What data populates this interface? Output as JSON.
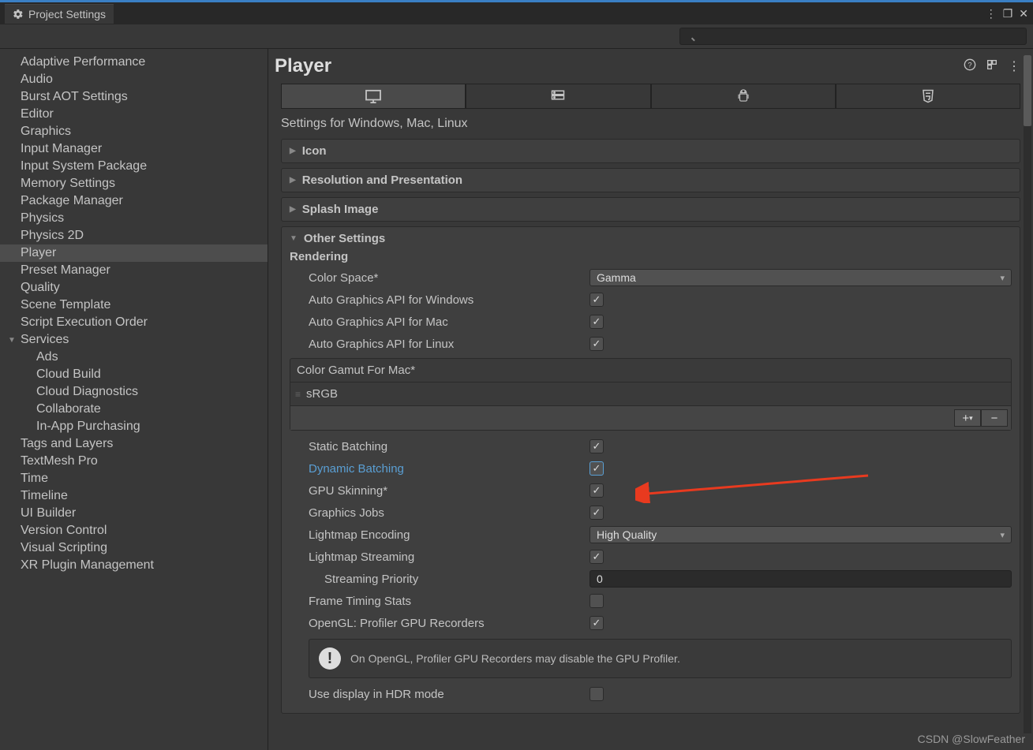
{
  "window": {
    "title": "Project Settings"
  },
  "search": {
    "placeholder": ""
  },
  "sidebar": {
    "items": [
      {
        "label": "Adaptive Performance"
      },
      {
        "label": "Audio"
      },
      {
        "label": "Burst AOT Settings"
      },
      {
        "label": "Editor"
      },
      {
        "label": "Graphics"
      },
      {
        "label": "Input Manager"
      },
      {
        "label": "Input System Package"
      },
      {
        "label": "Memory Settings"
      },
      {
        "label": "Package Manager"
      },
      {
        "label": "Physics"
      },
      {
        "label": "Physics 2D"
      },
      {
        "label": "Player",
        "selected": true
      },
      {
        "label": "Preset Manager"
      },
      {
        "label": "Quality"
      },
      {
        "label": "Scene Template"
      },
      {
        "label": "Script Execution Order"
      }
    ],
    "services": {
      "label": "Services",
      "children": [
        {
          "label": "Ads"
        },
        {
          "label": "Cloud Build"
        },
        {
          "label": "Cloud Diagnostics"
        },
        {
          "label": "Collaborate"
        },
        {
          "label": "In-App Purchasing"
        }
      ]
    },
    "items2": [
      {
        "label": "Tags and Layers"
      },
      {
        "label": "TextMesh Pro"
      },
      {
        "label": "Time"
      },
      {
        "label": "Timeline"
      },
      {
        "label": "UI Builder"
      },
      {
        "label": "Version Control"
      },
      {
        "label": "Visual Scripting"
      },
      {
        "label": "XR Plugin Management"
      }
    ]
  },
  "content": {
    "title": "Player",
    "platform_section": "Settings for Windows, Mac, Linux",
    "foldouts": {
      "icon": "Icon",
      "resolution": "Resolution and Presentation",
      "splash": "Splash Image",
      "other": "Other Settings"
    },
    "rendering": {
      "heading": "Rendering",
      "color_space_label": "Color Space*",
      "color_space_value": "Gamma",
      "auto_win": "Auto Graphics API  for Windows",
      "auto_mac": "Auto Graphics API  for Mac",
      "auto_linux": "Auto Graphics API  for Linux",
      "gamut_header": "Color Gamut For Mac*",
      "gamut_item": "sRGB",
      "static_batching": "Static Batching",
      "dynamic_batching": "Dynamic Batching",
      "gpu_skinning": "GPU Skinning*",
      "graphics_jobs": "Graphics Jobs",
      "lightmap_encoding_label": "Lightmap Encoding",
      "lightmap_encoding_value": "High Quality",
      "lightmap_streaming": "Lightmap Streaming",
      "streaming_priority_label": "Streaming Priority",
      "streaming_priority_value": "0",
      "frame_timing": "Frame Timing Stats",
      "opengl_recorders": "OpenGL: Profiler GPU Recorders",
      "info_text": "On OpenGL, Profiler GPU Recorders may disable the GPU Profiler.",
      "hdr_mode": "Use display in HDR mode",
      "checks": {
        "auto_win": true,
        "auto_mac": true,
        "auto_linux": true,
        "static_batching": true,
        "dynamic_batching": true,
        "gpu_skinning": true,
        "graphics_jobs": true,
        "lightmap_streaming": true,
        "frame_timing": false,
        "opengl_recorders": true,
        "hdr_mode": false
      }
    }
  },
  "watermark": "CSDN @SlowFeather"
}
